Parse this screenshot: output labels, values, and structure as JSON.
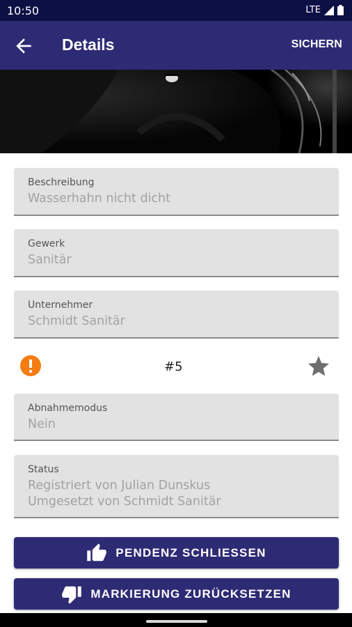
{
  "status_bar": {
    "time": "10:50",
    "network": "LTE"
  },
  "app_bar": {
    "title": "Details",
    "save_label": "SICHERN",
    "back_icon": "arrow-back-icon"
  },
  "fields": [
    {
      "label": "Beschreibung",
      "value": "Wasserhahn nicht dicht"
    },
    {
      "label": "Gewerk",
      "value": "Sanitär"
    },
    {
      "label": "Unternehmer",
      "value": "Schmidt Sanitär"
    },
    {
      "label": "Abnahmemodus",
      "value": "Nein"
    },
    {
      "label": "Status",
      "value_line1": "Registriert von Julian Dunskus",
      "value_line2": "Umgesetzt von Schmidt Sanitär"
    }
  ],
  "issue": {
    "number": "#5",
    "priority_icon": "warning-icon",
    "favorite_icon": "star-icon"
  },
  "buttons": {
    "close_label": "PENDENZ SCHLIESSEN",
    "close_icon": "thumbs-up-icon",
    "reset_label": "MARKIERUNG ZURÜCKSETZEN",
    "reset_icon": "thumbs-down-icon"
  },
  "colors": {
    "app_bar": "#2e2b75",
    "status_bar": "#0d1045",
    "warning": "#f47c12",
    "star": "#6e6e6e",
    "field_bg": "#e2e2e2"
  }
}
